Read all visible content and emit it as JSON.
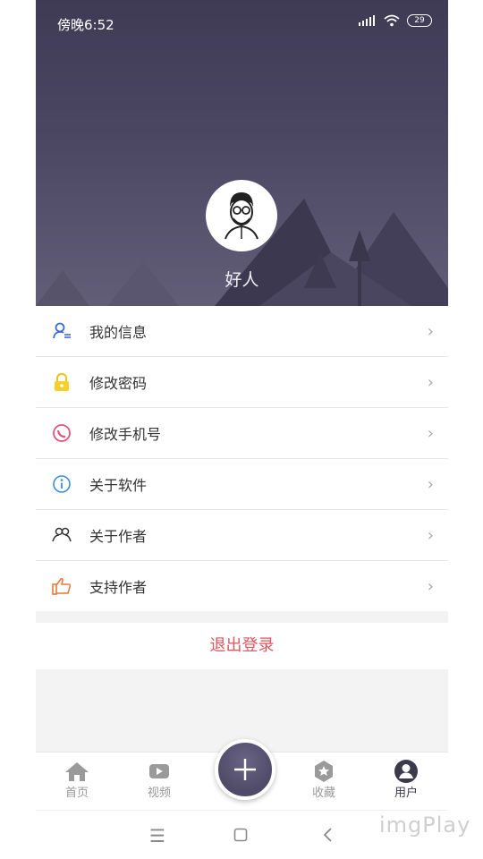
{
  "status": {
    "time": "傍晚6:52",
    "battery": "29"
  },
  "profile": {
    "username": "好人"
  },
  "menu": [
    {
      "label": "我的信息",
      "icon": "user-info-icon",
      "color": "#3a6fd8"
    },
    {
      "label": "修改密码",
      "icon": "lock-icon",
      "color": "#f0c419"
    },
    {
      "label": "修改手机号",
      "icon": "phone-icon",
      "color": "#e0557a"
    },
    {
      "label": "关于软件",
      "icon": "info-icon",
      "color": "#3a8de0"
    },
    {
      "label": "关于作者",
      "icon": "people-icon",
      "color": "#333333"
    },
    {
      "label": "支持作者",
      "icon": "thumbs-up-icon",
      "color": "#e87a3a"
    }
  ],
  "logout_label": "退出登录",
  "tabs": [
    {
      "label": "首页",
      "icon": "home-icon"
    },
    {
      "label": "视频",
      "icon": "video-icon"
    },
    {
      "label": "收藏",
      "icon": "star-badge-icon"
    },
    {
      "label": "用户",
      "icon": "user-icon",
      "active": true
    }
  ],
  "watermark": "imgPlay",
  "colors": {
    "accent": "#4f4a68",
    "logout": "#e0555f"
  }
}
